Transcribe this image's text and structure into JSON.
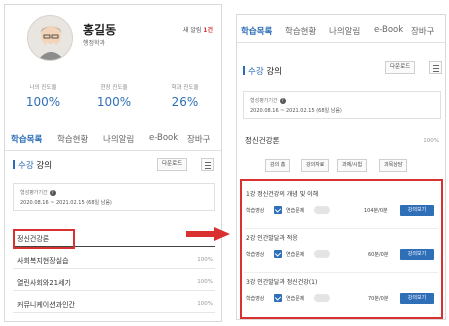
{
  "left": {
    "profile": {
      "name": "홍길동",
      "department": "행정학과",
      "notice_prefix": "새 알림",
      "notice_count": "1건"
    },
    "stats": [
      {
        "label": "나의 진도율",
        "value": "100%"
      },
      {
        "label": "현장 진도율",
        "value": "100%"
      },
      {
        "label": "학과 진도율",
        "value": "26%"
      }
    ],
    "tabs": [
      "학습목록",
      "학습현황",
      "나의알림",
      "e-Book",
      "장바구"
    ],
    "section": {
      "title_highlight": "수강",
      "title_rest": " 강의",
      "download": "다운로드"
    },
    "period": {
      "label": "형성평가기간",
      "value": "2020.08.16 ~ 2021.02.15 (68일 남음)"
    },
    "courses": [
      {
        "name": "정신건강론",
        "percent": ""
      },
      {
        "name": "사회복지현장실습",
        "percent": "100%"
      },
      {
        "name": "열린사회와21세기",
        "percent": "100%"
      },
      {
        "name": "커뮤니케이션과인간",
        "percent": "100%"
      }
    ]
  },
  "right": {
    "tabs": [
      "학습목록",
      "학습현황",
      "나의알림",
      "e-Book",
      "장바구"
    ],
    "section": {
      "title_highlight": "수강",
      "title_rest": " 강의",
      "download": "다운로드"
    },
    "period": {
      "label": "형성평가기간",
      "value": "2020.08.16 ~ 2021.02.15 (68일 남음)"
    },
    "course": {
      "name": "정신건강론",
      "percent": "100%"
    },
    "filters": [
      "강의 홈",
      "강의자료",
      "과제/시험",
      "과목상담"
    ],
    "lectures": [
      {
        "title": "1강 정신건강의 개념 및 이해",
        "video": "학습영상",
        "quiz": "연습문제",
        "duration": "104분/0분",
        "button": "강의보기"
      },
      {
        "title": "2강 인간발달과 적응",
        "video": "학습영상",
        "quiz": "연습문제",
        "duration": "60분/0분",
        "button": "강의보기"
      },
      {
        "title": "3강 인간발달과 정신건강(1)",
        "video": "학습영상",
        "quiz": "연습문제",
        "duration": "70분/0분",
        "button": "강의보기"
      }
    ]
  },
  "colors": {
    "accent": "#2d6cb7",
    "highlight": "#d93030",
    "button": "#2f6fb8"
  }
}
